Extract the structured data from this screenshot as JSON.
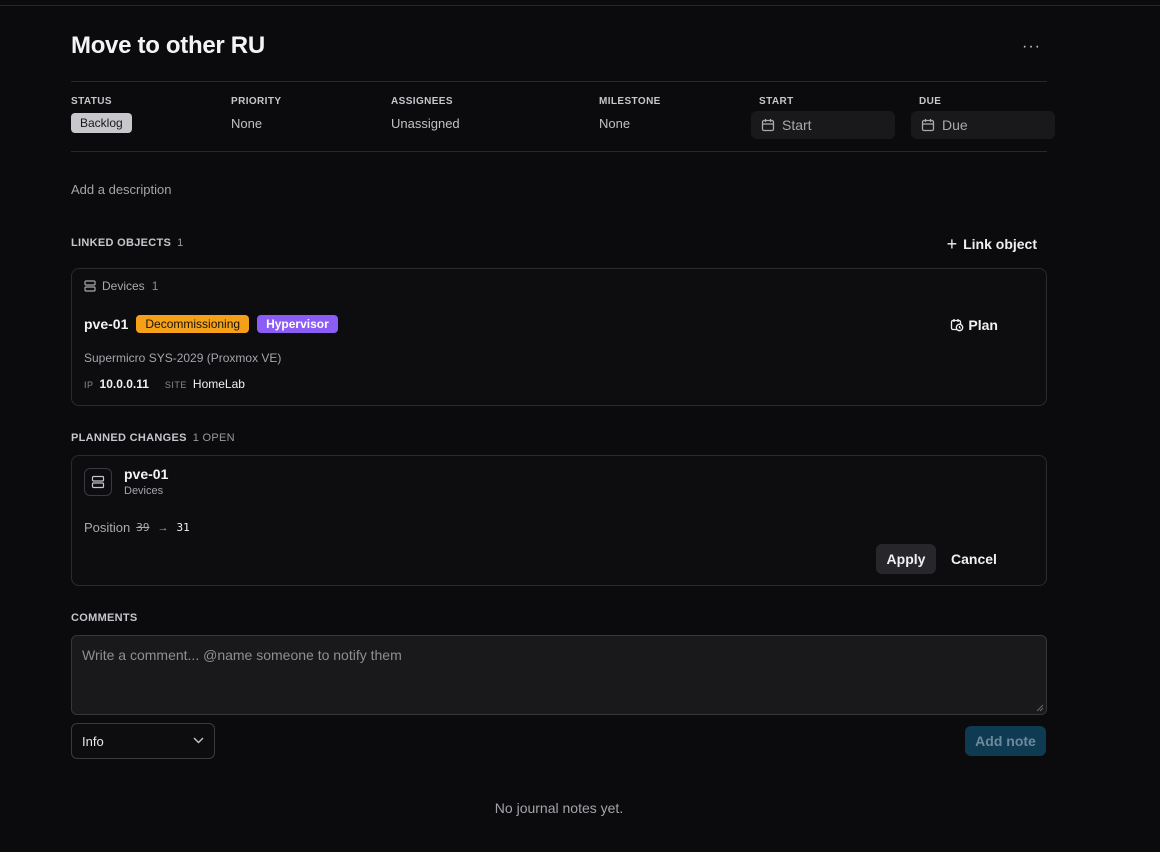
{
  "header": {
    "title": "Move to other RU",
    "more_label": "···"
  },
  "meta": {
    "status": {
      "label": "STATUS",
      "value": "Backlog"
    },
    "priority": {
      "label": "PRIORITY",
      "value": "None"
    },
    "assignees": {
      "label": "ASSIGNEES",
      "value": "Unassigned"
    },
    "milestone": {
      "label": "MILESTONE",
      "value": "None"
    },
    "start": {
      "label": "START",
      "value": "Start"
    },
    "due": {
      "label": "DUE",
      "value": "Due"
    }
  },
  "description": {
    "placeholder": "Add a description"
  },
  "linked": {
    "heading": "LINKED OBJECTS",
    "count": "1",
    "link_button": "Link object",
    "group": {
      "label": "Devices",
      "count": "1"
    },
    "device": {
      "name": "pve-01",
      "tags": [
        {
          "label": "Decommissioning",
          "color": "#f5a019"
        },
        {
          "label": "Hypervisor",
          "color": "#8b5cf6"
        }
      ],
      "model": "Supermicro SYS-2029 (Proxmox VE)",
      "ip_label": "IP",
      "ip": "10.0.0.11",
      "site_label": "SITE",
      "site": "HomeLab",
      "plan_button": "Plan"
    }
  },
  "planned": {
    "heading": "PLANNED CHANGES",
    "count": "1 OPEN",
    "item": {
      "name": "pve-01",
      "type": "Devices",
      "field": "Position",
      "old_value": "39",
      "arrow": "→",
      "new_value": "31",
      "apply_button": "Apply",
      "cancel_button": "Cancel"
    }
  },
  "comments": {
    "heading": "COMMENTS",
    "placeholder": "Write a comment... @name someone to notify them",
    "type_select": "Info",
    "add_button": "Add note",
    "empty_text": "No journal notes yet."
  },
  "colors": {
    "background": "#0b0b0d",
    "accent_button": "#0e3a52"
  }
}
